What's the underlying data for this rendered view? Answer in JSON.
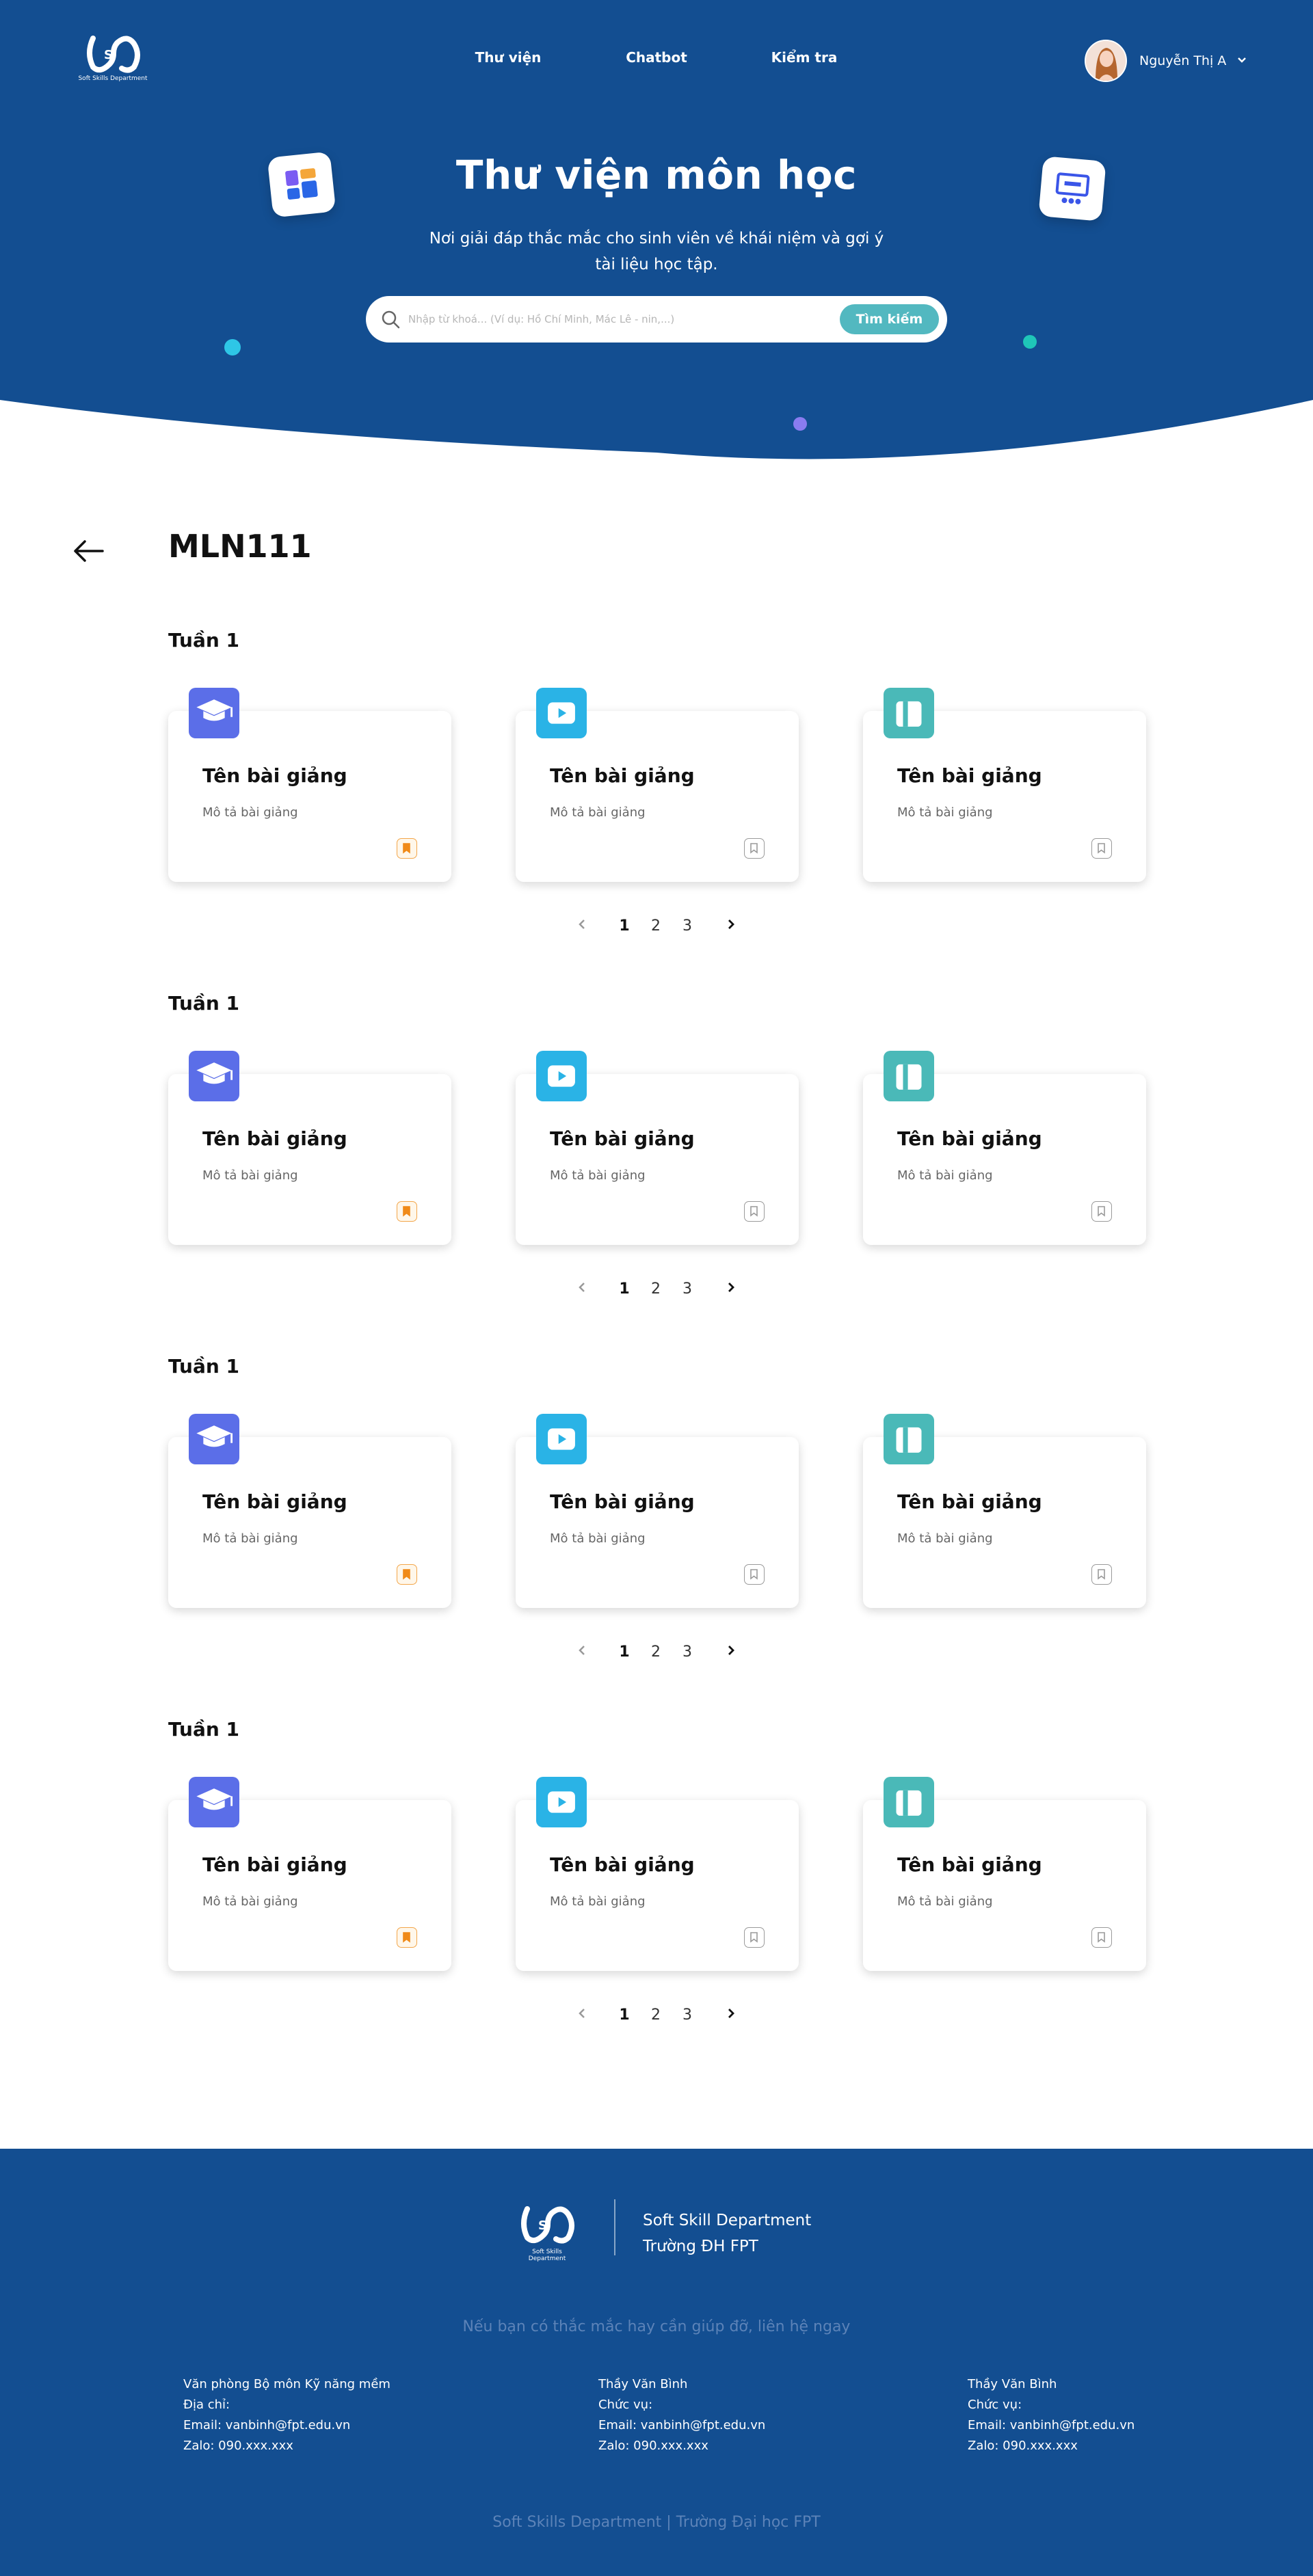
{
  "brand": {
    "logo_text": "Soft Skills Department"
  },
  "nav": {
    "items": [
      "Thư viện",
      "Chatbot",
      "Kiểm tra"
    ]
  },
  "user": {
    "name": "Nguyễn Thị A"
  },
  "hero": {
    "title": "Thư viện môn học",
    "subtitle": "Nơi giải đáp thắc mắc cho sinh viên về khái niệm và gợi ý tài liệu học tập.",
    "search_placeholder": "Nhập từ khoá... (Ví dụ: Hồ Chí Minh, Mác Lê - nin,...)",
    "search_button": "Tìm kiếm"
  },
  "course": {
    "code": "MLN111"
  },
  "weeks": [
    {
      "title": "Tuần 1",
      "cards": [
        {
          "icon": "graduation-cap-icon",
          "title": "Tên bài giảng",
          "desc": "Mô tả bài giảng",
          "bookmarked": true
        },
        {
          "icon": "video-play-icon",
          "title": "Tên bài giảng",
          "desc": "Mô tả bài giảng",
          "bookmarked": false
        },
        {
          "icon": "book-icon",
          "title": "Tên bài giảng",
          "desc": "Mô tả bài giảng",
          "bookmarked": false
        }
      ],
      "pages": [
        "1",
        "2",
        "3"
      ],
      "current_page": "1"
    },
    {
      "title": "Tuần 1",
      "cards": [
        {
          "icon": "graduation-cap-icon",
          "title": "Tên bài giảng",
          "desc": "Mô tả bài giảng",
          "bookmarked": true
        },
        {
          "icon": "video-play-icon",
          "title": "Tên bài giảng",
          "desc": "Mô tả bài giảng",
          "bookmarked": false
        },
        {
          "icon": "book-icon",
          "title": "Tên bài giảng",
          "desc": "Mô tả bài giảng",
          "bookmarked": false
        }
      ],
      "pages": [
        "1",
        "2",
        "3"
      ],
      "current_page": "1"
    },
    {
      "title": "Tuần 1",
      "cards": [
        {
          "icon": "graduation-cap-icon",
          "title": "Tên bài giảng",
          "desc": "Mô tả bài giảng",
          "bookmarked": true
        },
        {
          "icon": "video-play-icon",
          "title": "Tên bài giảng",
          "desc": "Mô tả bài giảng",
          "bookmarked": false
        },
        {
          "icon": "book-icon",
          "title": "Tên bài giảng",
          "desc": "Mô tả bài giảng",
          "bookmarked": false
        }
      ],
      "pages": [
        "1",
        "2",
        "3"
      ],
      "current_page": "1"
    },
    {
      "title": "Tuần 1",
      "cards": [
        {
          "icon": "graduation-cap-icon",
          "title": "Tên bài giảng",
          "desc": "Mô tả bài giảng",
          "bookmarked": true
        },
        {
          "icon": "video-play-icon",
          "title": "Tên bài giảng",
          "desc": "Mô tả bài giảng",
          "bookmarked": false
        },
        {
          "icon": "book-icon",
          "title": "Tên bài giảng",
          "desc": "Mô tả bài giảng",
          "bookmarked": false
        }
      ],
      "pages": [
        "1",
        "2",
        "3"
      ],
      "current_page": "1"
    }
  ],
  "footer": {
    "dept_line1": "Soft Skill Department",
    "dept_line2": "Trường ĐH FPT",
    "help": "Nếu bạn có thắc mắc hay cần giúp đỡ, liên hệ ngay",
    "columns": [
      [
        "Văn phòng Bộ môn Kỹ năng mềm",
        "Địa chỉ:",
        "Email: vanbinh@fpt.edu.vn",
        "Zalo: 090.xxx.xxx"
      ],
      [
        "Thầy Văn Bình",
        "Chức vụ:",
        "Email: vanbinh@fpt.edu.vn",
        "Zalo: 090.xxx.xxx"
      ],
      [
        "Thầy Văn Bình",
        "Chức vụ:",
        "Email: vanbinh@fpt.edu.vn",
        "Zalo: 090.xxx.xxx"
      ]
    ],
    "copyright": "Soft Skills Department | Trường Đại học FPT"
  },
  "colors": {
    "primary_blue": "#134e91",
    "teal": "#52b8c0",
    "badge_cap": "#5b6ee8",
    "badge_video": "#2ab3e6",
    "badge_book": "#4ab9b8",
    "bookmark_active": "#f08a18"
  }
}
